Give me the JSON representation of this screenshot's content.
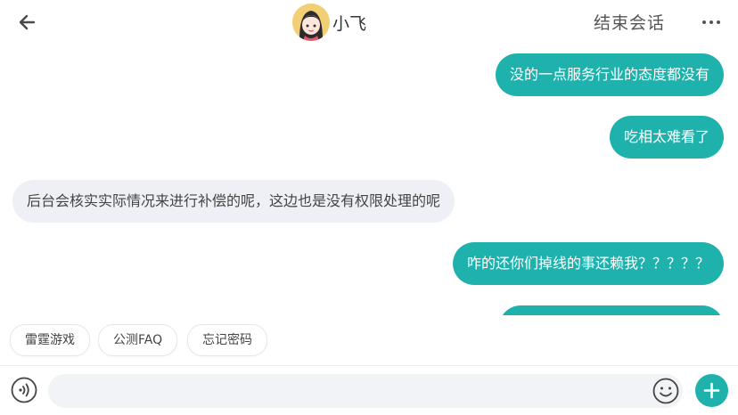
{
  "header": {
    "back_icon": "arrow-left-icon",
    "title": "小飞",
    "end_label": "结束会话",
    "more_icon": "more-horizontal-icon"
  },
  "messages": [
    {
      "side": "out",
      "text": "没的一点服务行业的态度都没有"
    },
    {
      "side": "out",
      "text": "吃相太难看了"
    },
    {
      "side": "in",
      "text": "后台会核实实际情况来进行补偿的呢，这边也是没有权限处理的呢"
    },
    {
      "side": "out",
      "text": "咋的还你们掉线的事还赖我？？？？？"
    },
    {
      "side": "out",
      "text": ""
    }
  ],
  "quick_replies": [
    "雷霆游戏",
    "公测FAQ",
    "忘记密码"
  ],
  "input": {
    "value": "",
    "placeholder": ""
  },
  "colors": {
    "accent": "#1fb2ad",
    "incoming_bubble": "#eef0f6"
  }
}
